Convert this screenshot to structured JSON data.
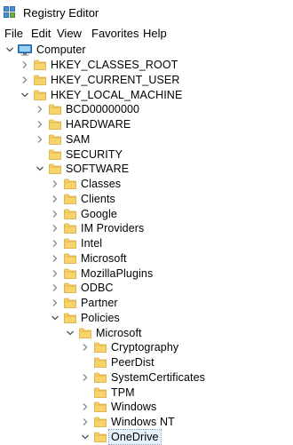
{
  "window": {
    "title": "Registry Editor"
  },
  "menu": [
    "File",
    "Edit",
    "View",
    "Favorites",
    "Help"
  ],
  "tree": [
    {
      "label": "Computer",
      "level": 0,
      "expander": "expanded",
      "icon": "computer-icon"
    },
    {
      "label": "HKEY_CLASSES_ROOT",
      "level": 1,
      "expander": "collapsed",
      "icon": "folder-icon"
    },
    {
      "label": "HKEY_CURRENT_USER",
      "level": 1,
      "expander": "collapsed",
      "icon": "folder-icon"
    },
    {
      "label": "HKEY_LOCAL_MACHINE",
      "level": 1,
      "expander": "expanded",
      "icon": "folder-icon"
    },
    {
      "label": "BCD00000000",
      "level": 2,
      "expander": "collapsed",
      "icon": "folder-icon"
    },
    {
      "label": "HARDWARE",
      "level": 2,
      "expander": "collapsed",
      "icon": "folder-icon"
    },
    {
      "label": "SAM",
      "level": 2,
      "expander": "collapsed",
      "icon": "folder-icon"
    },
    {
      "label": "SECURITY",
      "level": 2,
      "expander": "none",
      "icon": "folder-icon"
    },
    {
      "label": "SOFTWARE",
      "level": 2,
      "expander": "expanded",
      "icon": "folder-icon"
    },
    {
      "label": "Classes",
      "level": 3,
      "expander": "collapsed",
      "icon": "folder-icon"
    },
    {
      "label": "Clients",
      "level": 3,
      "expander": "collapsed",
      "icon": "folder-icon"
    },
    {
      "label": "Google",
      "level": 3,
      "expander": "collapsed",
      "icon": "folder-icon"
    },
    {
      "label": "IM Providers",
      "level": 3,
      "expander": "collapsed",
      "icon": "folder-icon"
    },
    {
      "label": "Intel",
      "level": 3,
      "expander": "collapsed",
      "icon": "folder-icon"
    },
    {
      "label": "Microsoft",
      "level": 3,
      "expander": "collapsed",
      "icon": "folder-icon"
    },
    {
      "label": "MozillaPlugins",
      "level": 3,
      "expander": "collapsed",
      "icon": "folder-icon"
    },
    {
      "label": "ODBC",
      "level": 3,
      "expander": "collapsed",
      "icon": "folder-icon"
    },
    {
      "label": "Partner",
      "level": 3,
      "expander": "collapsed",
      "icon": "folder-icon"
    },
    {
      "label": "Policies",
      "level": 3,
      "expander": "expanded",
      "icon": "folder-icon"
    },
    {
      "label": "Microsoft",
      "level": 4,
      "expander": "expanded",
      "icon": "folder-icon"
    },
    {
      "label": "Cryptography",
      "level": 5,
      "expander": "collapsed",
      "icon": "folder-icon"
    },
    {
      "label": "PeerDist",
      "level": 5,
      "expander": "none",
      "icon": "folder-icon"
    },
    {
      "label": "SystemCertificates",
      "level": 5,
      "expander": "collapsed",
      "icon": "folder-icon"
    },
    {
      "label": "TPM",
      "level": 5,
      "expander": "none",
      "icon": "folder-icon"
    },
    {
      "label": "Windows",
      "level": 5,
      "expander": "collapsed",
      "icon": "folder-icon"
    },
    {
      "label": "Windows NT",
      "level": 5,
      "expander": "collapsed",
      "icon": "folder-icon"
    },
    {
      "label": "OneDrive",
      "level": 5,
      "expander": "expanded",
      "icon": "folder-icon",
      "selected": true
    }
  ],
  "colors": {
    "folder": "#f6d36b",
    "folder_edge": "#d9a93a",
    "computer": "#3b8fd6",
    "selection": "#e5f1fb"
  }
}
